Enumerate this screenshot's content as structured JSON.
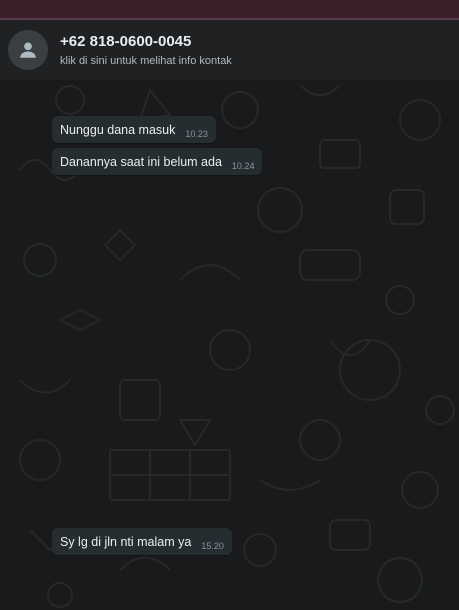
{
  "header": {
    "contact_name": "+62 818-0600-0045",
    "contact_subtitle": "klik di sini untuk melihat info kontak",
    "avatar_icon": "person-icon"
  },
  "messages": [
    {
      "text": "Nunggu dana masuk",
      "time": "10.23"
    },
    {
      "text": "Danannya saat ini belum ada",
      "time": "10.24"
    },
    {
      "text": "Sy lg di jln nti malam ya",
      "time": "15.20"
    }
  ],
  "colors": {
    "header_bg": "#1f2123",
    "chat_bg": "#181a1b",
    "bubble_bg": "#262d31",
    "top_strip": "#3a1f2a"
  }
}
